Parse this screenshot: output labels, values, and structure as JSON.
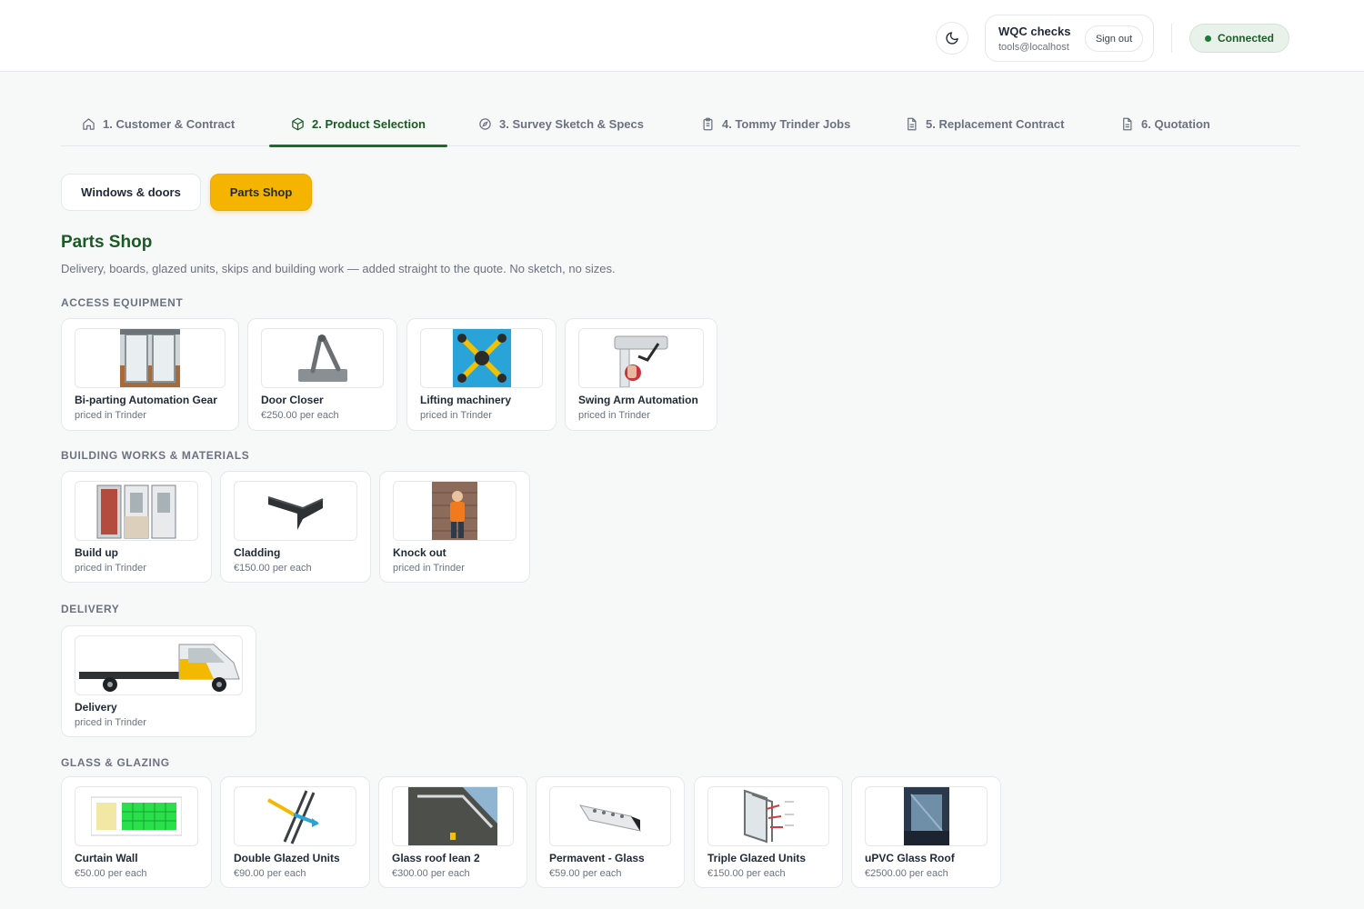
{
  "header": {
    "user": {
      "name": "WQC checks",
      "email": "tools@localhost",
      "signout_label": "Sign out"
    },
    "status_label": "Connected",
    "status_color": "#1e7a34"
  },
  "tabs": [
    {
      "label": "1. Customer & Contract",
      "icon": "home-icon",
      "active": false
    },
    {
      "label": "2. Product Selection",
      "icon": "cube-icon",
      "active": true
    },
    {
      "label": "3. Survey Sketch & Specs",
      "icon": "compass-icon",
      "active": false
    },
    {
      "label": "4. Tommy Trinder Jobs",
      "icon": "clipboard-icon",
      "active": false
    },
    {
      "label": "5. Replacement Contract",
      "icon": "document-icon",
      "active": false
    },
    {
      "label": "6. Quotation",
      "icon": "document-icon",
      "active": false
    }
  ],
  "sub_toggle": {
    "windows_label": "Windows & doors",
    "parts_label": "Parts Shop",
    "active": "parts"
  },
  "page": {
    "title": "Parts Shop",
    "subtitle": "Delivery, boards, glazed units, skips and building work — added straight to the quote. No sketch, no sizes."
  },
  "sections": [
    {
      "heading": "Access equipment",
      "items": [
        {
          "name": "Bi-parting Automation Gear",
          "price": "priced in Trinder"
        },
        {
          "name": "Door Closer",
          "price": "€250.00 per each"
        },
        {
          "name": "Lifting machinery",
          "price": "priced in Trinder"
        },
        {
          "name": "Swing Arm Automation",
          "price": "priced in Trinder"
        }
      ]
    },
    {
      "heading": "Building works & materials",
      "items": [
        {
          "name": "Build up",
          "price": "priced in Trinder"
        },
        {
          "name": "Cladding",
          "price": "€150.00 per each"
        },
        {
          "name": "Knock out",
          "price": "priced in Trinder"
        }
      ]
    },
    {
      "heading": "Delivery",
      "items": [
        {
          "name": "Delivery",
          "price": "priced in Trinder"
        }
      ]
    },
    {
      "heading": "Glass & glazing",
      "items": [
        {
          "name": "Curtain Wall",
          "price": "€50.00 per each"
        },
        {
          "name": "Double Glazed Units",
          "price": "€90.00 per each"
        },
        {
          "name": "Glass roof lean 2",
          "price": "€300.00 per each"
        },
        {
          "name": "Permavent - Glass",
          "price": "€59.00 per each"
        },
        {
          "name": "Triple Glazed Units",
          "price": "€150.00 per each"
        },
        {
          "name": "uPVC Glass Roof",
          "price": "€2500.00 per each"
        }
      ]
    }
  ],
  "colors": {
    "brand_green": "#1a5a24",
    "accent_yellow": "#f5b400"
  }
}
